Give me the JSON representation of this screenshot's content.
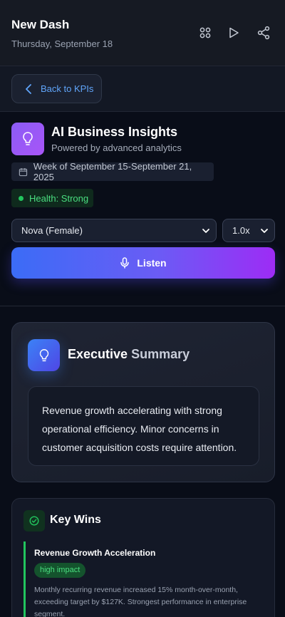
{
  "header": {
    "title": "New Dash",
    "date": "Thursday, September 18",
    "icons": [
      "grid-icon",
      "play-icon",
      "share-icon"
    ]
  },
  "nav": {
    "back_label": "Back to KPIs"
  },
  "insights": {
    "title": "AI Business Insights",
    "subtitle": "Powered by advanced analytics",
    "week": "Week of September 15-September 21, 2025",
    "health": "Health: Strong",
    "voice_select": "Nova (Female)",
    "speed_select": "1.0x",
    "listen_label": "Listen"
  },
  "executive_summary": {
    "title_main": "Executive",
    "title_muted": "Summary",
    "body": "Revenue growth accelerating with strong operational efficiency. Minor concerns in customer acquisition costs require attention."
  },
  "key_wins": {
    "title": "Key Wins",
    "items": [
      {
        "title": "Revenue Growth Acceleration",
        "impact": "high impact",
        "description": "Monthly recurring revenue increased 15% month-over-month, exceeding target by $127K. Strongest performance in enterprise segment."
      }
    ]
  },
  "colors": {
    "accent_blue": "#60a5fa",
    "success": "#22c55e",
    "purple": "#a855f7",
    "background": "#090d18"
  }
}
